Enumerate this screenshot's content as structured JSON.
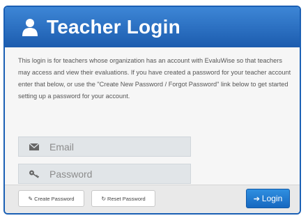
{
  "header": {
    "title": "Teacher Login"
  },
  "description": "This login is for teachers whose organization has an account with EvaluWise so that teachers may access and view their evaluations. If you have created a password for your teacher account enter that below, or use the \"Create New Password / Forgot Password\" link below to get started setting up a password for your account.",
  "form": {
    "email_placeholder": "Email",
    "password_placeholder": "Password"
  },
  "footer": {
    "create_label": "Create Password",
    "reset_label": "Reset Password",
    "login_label": "Login"
  },
  "icons": {
    "header": "user-icon",
    "email": "envelope-icon",
    "password": "key-icon",
    "create": "pencil-icon",
    "reset": "refresh-icon",
    "login": "sign-in-icon"
  },
  "colors": {
    "header_top": "#3d86d6",
    "header_bottom": "#1c5cae",
    "login_button": "#1f76cf"
  }
}
